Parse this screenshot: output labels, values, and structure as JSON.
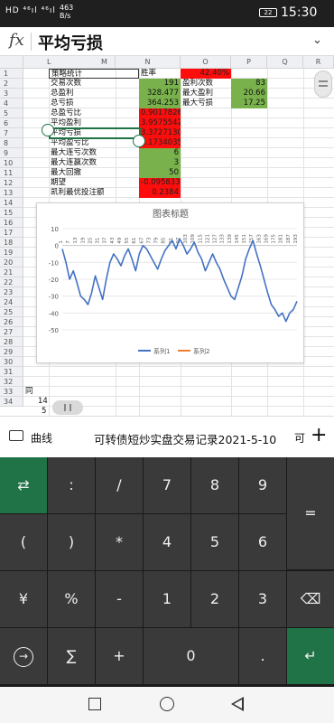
{
  "status_bar": {
    "signal": "HD ⁴⁶ıl ⁴⁶ıl",
    "net_speed": "463",
    "net_unit": "B/s",
    "battery": "22",
    "time": "15:30"
  },
  "formula_bar": {
    "fx": "fx",
    "content": "平均亏损"
  },
  "sheet": {
    "columns": [
      "L",
      "M",
      "N",
      "O",
      "P",
      "Q",
      "R"
    ],
    "rows": [
      "1",
      "2",
      "3",
      "4",
      "5",
      "6",
      "7",
      "8",
      "9",
      "10",
      "11",
      "12",
      "13",
      "14",
      "15",
      "16",
      "17",
      "18",
      "19",
      "20",
      "21",
      "22",
      "23",
      "24",
      "25",
      "26",
      "27",
      "28",
      "29",
      "30",
      "31",
      "32",
      "33",
      "34"
    ],
    "cells": {
      "l1": "策略统计",
      "n1": "胜率",
      "o1": "42.40%",
      "l2": "交易次数",
      "n2": "191",
      "o2": "盈利次数",
      "p2": "83",
      "l3": "总盈利",
      "n3": "328.477",
      "o3": "最大盈利",
      "p3": "20.66",
      "l4": "总亏损",
      "n4": "364.253",
      "o4": "最大亏损",
      "p4": "17.25",
      "l5": "总盈亏比",
      "n5": "0.9017826",
      "l6": "平均盈利",
      "n6": "3.9575542",
      "l7": "平均亏损",
      "n7": "3.3727130",
      "l8": "平均盈亏比",
      "n8": "1.1734035",
      "l9": "最大连亏次数",
      "n9": "6",
      "l10": "最大连赢次数",
      "n10": "3",
      "l11": "最大回撤",
      "n11": "50",
      "l12": "期望",
      "n12": "-0.095833",
      "l13": "凯利最优投注额",
      "n13": "0.2384",
      "l32": "同",
      "l33": "14",
      "l34": "5"
    }
  },
  "chart_data": {
    "type": "line",
    "title": "图表标题",
    "ylim": [
      -50,
      10
    ],
    "yticks": [
      10,
      0,
      -10,
      -20,
      -30,
      -40,
      -50
    ],
    "xticks": [
      "1",
      "7",
      "13",
      "19",
      "25",
      "31",
      "37",
      "43",
      "49",
      "55",
      "61",
      "67",
      "73",
      "79",
      "85",
      "91",
      "97",
      "103",
      "109",
      "115",
      "121",
      "127",
      "133",
      "139",
      "145",
      "151",
      "157",
      "163",
      "169",
      "175",
      "181",
      "187",
      "193"
    ],
    "grid": true,
    "legend_position": "bottom",
    "series": [
      {
        "name": "系列1",
        "color": "#4472c4",
        "x": [
          1,
          4,
          7,
          10,
          13,
          16,
          19,
          22,
          25,
          28,
          31,
          34,
          37,
          40,
          43,
          46,
          49,
          52,
          55,
          58,
          61,
          64,
          67,
          70,
          73,
          76,
          79,
          82,
          85,
          88,
          91,
          94,
          97,
          100,
          103,
          106,
          109,
          112,
          115,
          118,
          121,
          124,
          127,
          130,
          133,
          136,
          139,
          142,
          145,
          148,
          151,
          154,
          157,
          160,
          163,
          166,
          169,
          172,
          175,
          178,
          181,
          184,
          187,
          190,
          193
        ],
        "values": [
          -2,
          -10,
          -20,
          -15,
          -22,
          -30,
          -32,
          -35,
          -28,
          -18,
          -25,
          -32,
          -20,
          -10,
          -5,
          -8,
          -12,
          -6,
          -2,
          -8,
          -15,
          -5,
          0,
          -2,
          -6,
          -10,
          -14,
          -8,
          -3,
          0,
          3,
          -2,
          4,
          0,
          -5,
          -2,
          2,
          -4,
          -8,
          -15,
          -10,
          -5,
          -10,
          -14,
          -20,
          -25,
          -30,
          -32,
          -25,
          -18,
          -8,
          -2,
          3,
          -5,
          -12,
          -20,
          -28,
          -35,
          -38,
          -42,
          -40,
          -45,
          -40,
          -38,
          -33
        ]
      },
      {
        "name": "系列2",
        "color": "#ed7d31",
        "x": [],
        "values": []
      }
    ]
  },
  "sheet_tabs": {
    "tab1": "曲线",
    "tab2": "可转债短炒实盘交易记录2021-5-10",
    "tab3": "可"
  },
  "keypad": {
    "keys": [
      ":",
      "/",
      "7",
      "8",
      "9",
      "=",
      "(",
      ")",
      "*",
      "4",
      "5",
      "6",
      "¥",
      "%",
      "-",
      "1",
      "2",
      "3",
      "∑",
      "+",
      "0",
      "."
    ],
    "tab_key": "⇄",
    "circle_arrow": "→",
    "backspace": "⌫",
    "enter": "↵"
  }
}
